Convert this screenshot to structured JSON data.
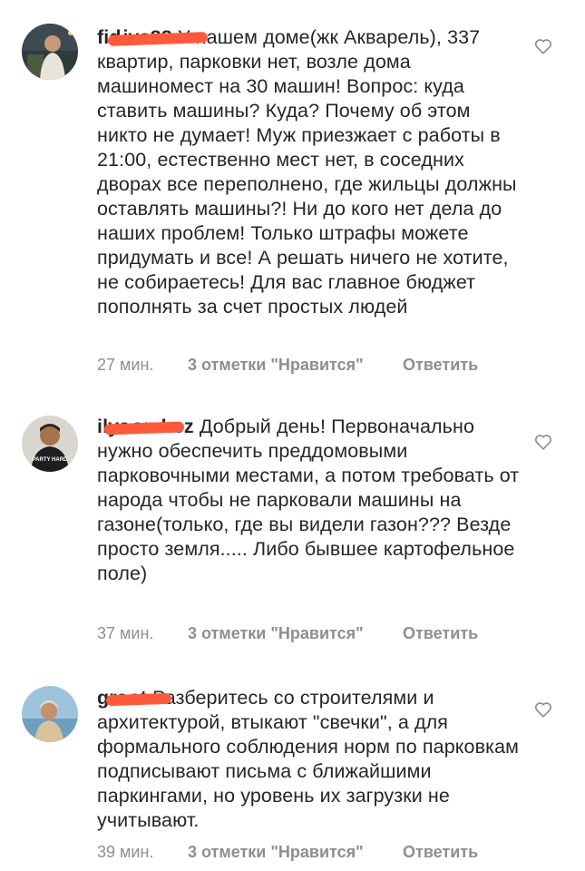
{
  "comments": [
    {
      "username": "fid iva88",
      "text": "У нашем доме(жк Акварель), 337 квартир, парковки нет, возле дома машиномест на 30 машин! Вопрос: куда ставить машины? Куда? Почему об этом никто не думает! Муж приезжает с работы в 21:00, естественно мест нет, в соседних дворах все переполнено, где жильцы должны оставлять машины?! Ни до кого нет дела до наших проблем! Только штрафы можете придумать и все! А решать ничего не хотите, не собираетесь! Для вас главное бюджет пополнять за счет простых людей",
      "time": "27 мин.",
      "likes": "3 отметки \"Нравится\"",
      "reply": "Ответить"
    },
    {
      "username": "ilya ombez",
      "text": "Добрый день! Первоначально нужно обеспечить преддомовыми парковочными местами, а потом требовать от народа чтобы не парковали машины на газоне(только, где вы видели газон??? Везде просто земля..... Либо бывшее картофельное поле)",
      "time": "37 мин.",
      "likes": "3 отметки \"Нравится\"",
      "reply": "Ответить"
    },
    {
      "username": "gra st",
      "text": "Разберитесь со строителями и архитектурой, втыкают \"свечки\", а для формального соблюдения норм по парковкам подписывают письма с ближайшими паркингами, но уровень их загрузки не учитывают.",
      "time": "39 мин.",
      "likes": "3 отметки \"Нравится\"",
      "reply": "Ответить"
    }
  ],
  "avatar_badge_text": "PARTY HARD",
  "colors": {
    "text": "#262626",
    "meta": "#8e8e8e",
    "redaction": "#ff5a3c"
  },
  "icons": {
    "like": "heart-outline-icon"
  }
}
